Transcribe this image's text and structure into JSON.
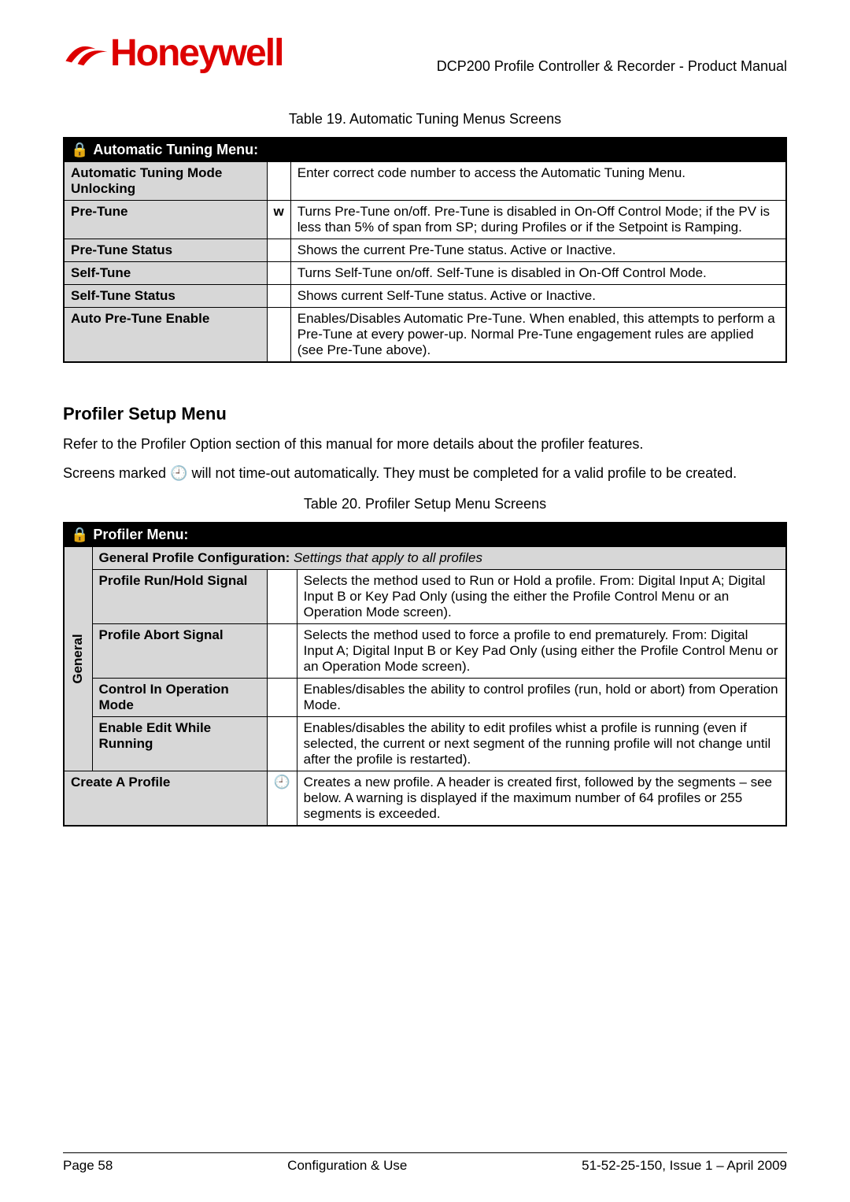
{
  "header": {
    "logo_text": "Honeywell",
    "doc_title": "DCP200 Profile Controller & Recorder - Product Manual"
  },
  "table19": {
    "caption": "Table 19. Automatic Tuning Menus Screens",
    "title": "Automatic Tuning Menu:",
    "rows": [
      {
        "name": "Automatic Tuning Mode Unlocking",
        "mid": "",
        "desc": "Enter correct code number to access the Automatic Tuning Menu."
      },
      {
        "name": "Pre-Tune",
        "mid": "w",
        "desc": "Turns Pre-Tune on/off. Pre-Tune is disabled in On-Off Control Mode; if the PV is less than 5% of span from SP; during Profiles or if the Setpoint is Ramping."
      },
      {
        "name": "Pre-Tune Status",
        "mid": "",
        "desc": "Shows the current Pre-Tune status. Active or Inactive."
      },
      {
        "name": "Self-Tune",
        "mid": "",
        "desc": "Turns Self-Tune on/off. Self-Tune is disabled in On-Off Control Mode."
      },
      {
        "name": "Self-Tune Status",
        "mid": "",
        "desc": "Shows current Self-Tune status. Active or Inactive."
      },
      {
        "name": "Auto Pre-Tune Enable",
        "mid": "",
        "desc": "Enables/Disables Automatic Pre-Tune. When enabled, this attempts to perform a Pre-Tune at every power-up. Normal Pre-Tune engagement rules are applied (see Pre-Tune above)."
      }
    ]
  },
  "profiler": {
    "heading": "Profiler Setup Menu",
    "para1": "Refer to the Profiler Option section of this manual for more details about the profiler features.",
    "para2a": "Screens marked ",
    "para2b": " will not time-out automatically. They must be completed for a valid profile to be created.",
    "clock_glyph": "🕘"
  },
  "table20": {
    "caption": "Table 20. Profiler Setup Menu Screens",
    "title": "Profiler Menu:",
    "category": "General",
    "subhead_bold": "General Profile Configuration:",
    "subhead_italic": "  Settings that apply to all profiles",
    "rows": [
      {
        "name": "Profile Run/Hold Signal",
        "mid": "",
        "desc": "Selects the method used to Run or Hold a profile. From: Digital Input A; Digital Input B or Key Pad Only (using the either the Profile Control Menu or an Operation Mode screen)."
      },
      {
        "name": "Profile Abort Signal",
        "mid": "",
        "desc": "Selects the method used to force a profile to end prematurely. From: Digital Input A; Digital Input B or Key Pad Only (using either the Profile Control Menu or an Operation Mode screen)."
      },
      {
        "name": "Control In Operation Mode",
        "mid": "",
        "desc": "Enables/disables the ability to control profiles (run, hold or abort) from Operation Mode."
      },
      {
        "name": "Enable Edit While Running",
        "mid": "",
        "desc": "Enables/disables the ability to edit profiles whist a profile is running (even if selected, the current or next segment of the running profile will not change until after the profile is restarted)."
      }
    ],
    "create_row": {
      "name": "Create A Profile",
      "mid": "🕘",
      "desc": "Creates a new profile. A header is created first, followed by the segments – see below. A warning is displayed if the maximum number of 64 profiles or 255 segments is exceeded."
    }
  },
  "footer": {
    "left": "Page 58",
    "center": "Configuration & Use",
    "right": "51-52-25-150, Issue 1 – April 2009"
  },
  "icons": {
    "lock": "🔒"
  }
}
